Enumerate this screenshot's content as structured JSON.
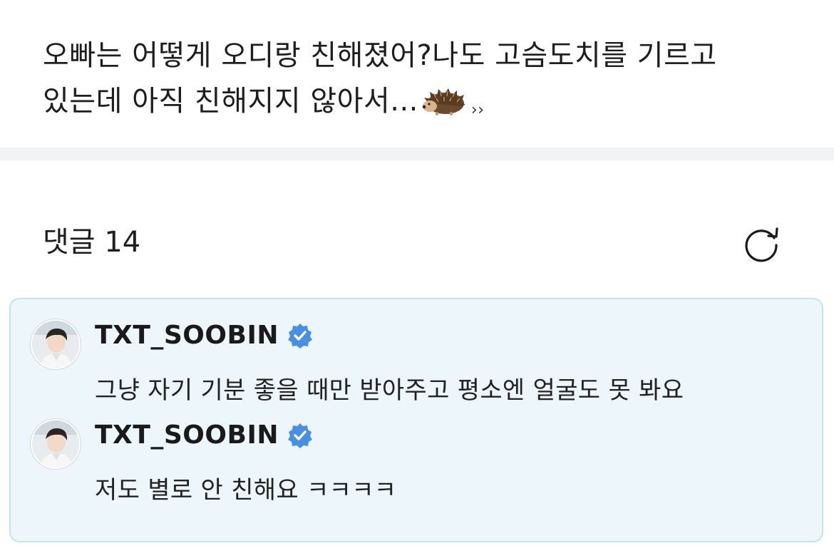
{
  "post": {
    "line1": "오빠는 어떻게 오디랑 친해졌어?나도 고슴도치를 기르고",
    "line2": "있는데 아직 친해지지 않아서...",
    "emoji": "hedgehog-emoji",
    "quote_mark": "››"
  },
  "comments_section": {
    "label": "댓글 14",
    "refresh_icon": "refresh-icon"
  },
  "comments": [
    {
      "username": "TXT_SOOBIN",
      "verified": true,
      "text": "그냥 자기 기분 좋을 때만 받아주고 평소엔 얼굴도 못 봐요"
    },
    {
      "username": "TXT_SOOBIN",
      "verified": true,
      "text": "저도 별로 안 친해요 ㅋㅋㅋㅋ"
    }
  ],
  "colors": {
    "comment_bg": "#ecf6fb",
    "comment_border": "#c4e3f2",
    "verified_badge": "#4a90e2",
    "divider": "#f2f3f5"
  }
}
